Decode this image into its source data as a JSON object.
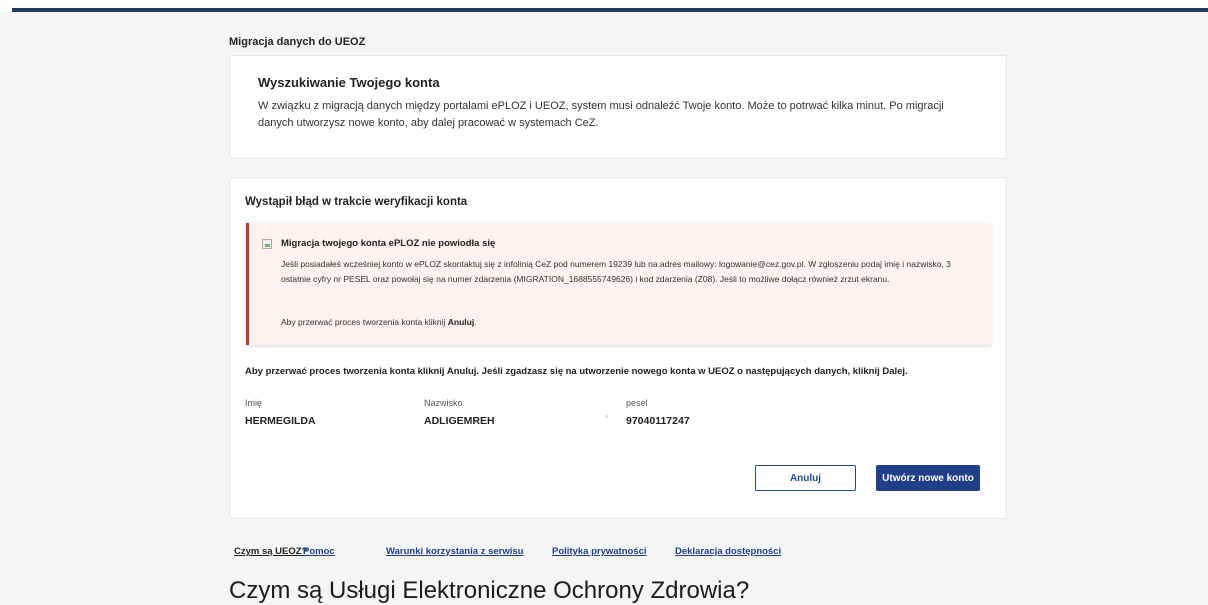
{
  "section_title": "Migracja danych do UEOZ",
  "search_card": {
    "title": "Wyszukiwanie Twojego konta",
    "text": "W związku z migracją danych między portalami ePLOZ i UEOZ, system musi odnaleźć Twoje konto. Może to potrwać kilka minut. Po migracji danych utworzysz nowe konto, aby dalej pracować w systemach CeZ."
  },
  "error_card": {
    "title": "Wystąpił błąd w trakcie weryfikacji konta",
    "alert": {
      "icon": "broken-image-icon",
      "title": "Migracja twojego konta ePLOZ nie powiodła się",
      "body": "Jeśli posiadałeś wcześniej konto w ePLOZ skontaktuj się z infolinią CeZ pod numerem 19239 lub na adres mailowy: logowanie@cez.gov.pl. W zgłoszeniu podaj imię i nazwisko, 3 ostatnie cyfry nr PESEL oraz powołaj się na numer zdarzenia (MIGRATION_1688555749626) i kod zdarzenia (Z08). Jeśli to możliwe dołącz również zrzut ekranu.",
      "cancel_prefix": "Aby przerwać proces tworzenia konta kliknij ",
      "cancel_bold": "Anuluj",
      "cancel_suffix": ".",
      "border_color": "#c0392b",
      "background_color": "#fdf2f0"
    },
    "instruction": "Aby przerwać proces tworzenia konta kliknij Anuluj. Jeśli zgadzasz się na utworzenie nowego konta w UEOZ o następujących danych, kliknij Dalej.",
    "fields": {
      "first_name": {
        "label": "Imię",
        "value": "HERMEGILDA"
      },
      "last_name": {
        "label": "Nazwisko",
        "value": "ADLIGEMREH"
      },
      "pesel": {
        "label": "pesel",
        "value": "97040117247"
      },
      "tick": "'"
    },
    "buttons": {
      "cancel": "Anuluj",
      "create": "Utwórz nowe konto"
    }
  },
  "footer_links": [
    "Czym są UEOZ?",
    "Pomoc",
    "Warunki korzystania z serwisu",
    "Polityka prywatności",
    "Deklaracja dostępności"
  ],
  "bottom_title": "Czym są Usługi Elektroniczne Ochrony Zdrowia?",
  "colors": {
    "primary": "#1f3f86",
    "header_line": "#1f3b5f",
    "page_background": "#f4f5f7"
  }
}
